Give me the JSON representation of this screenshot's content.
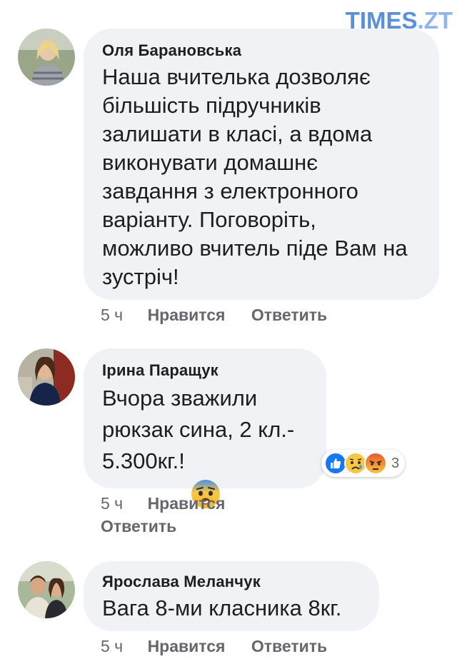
{
  "watermark": {
    "main": "TIMES",
    "suffix": ".ZT"
  },
  "comments": [
    {
      "author": "Оля Барановська",
      "text": "Наша вчителька дозволяє\nбільшість підручників\nзалишати в класі, а вдома\nвиконувати домашнє\nзавдання  з електронного\nваріанту. Поговоріть,\nможливо вчитель піде Вам на\nзустріч!",
      "time": "5 ч",
      "like_label": "Нравится",
      "reply_label": "Ответить"
    },
    {
      "author": "Ірина Паращук",
      "text": "Вчора зважили\nрюкзак сина, 2 кл.-\n5.300кг.!",
      "emoji": "fearful-face-icon",
      "time": "5 ч",
      "like_label": "Нравится",
      "reply_label": "Ответить",
      "reactions": {
        "icons": [
          "like-icon",
          "sad-icon",
          "angry-icon"
        ],
        "count": "3"
      }
    },
    {
      "author": "Ярослава Меланчук",
      "text": "Вага 8-ми класника 8кг.",
      "time": "5 ч",
      "like_label": "Нравится",
      "reply_label": "Ответить"
    }
  ],
  "colors": {
    "bubble": "#f0f2f5",
    "meta": "#65676b",
    "like_blue": "#1877f2",
    "watermark": "#5b8fd6"
  }
}
